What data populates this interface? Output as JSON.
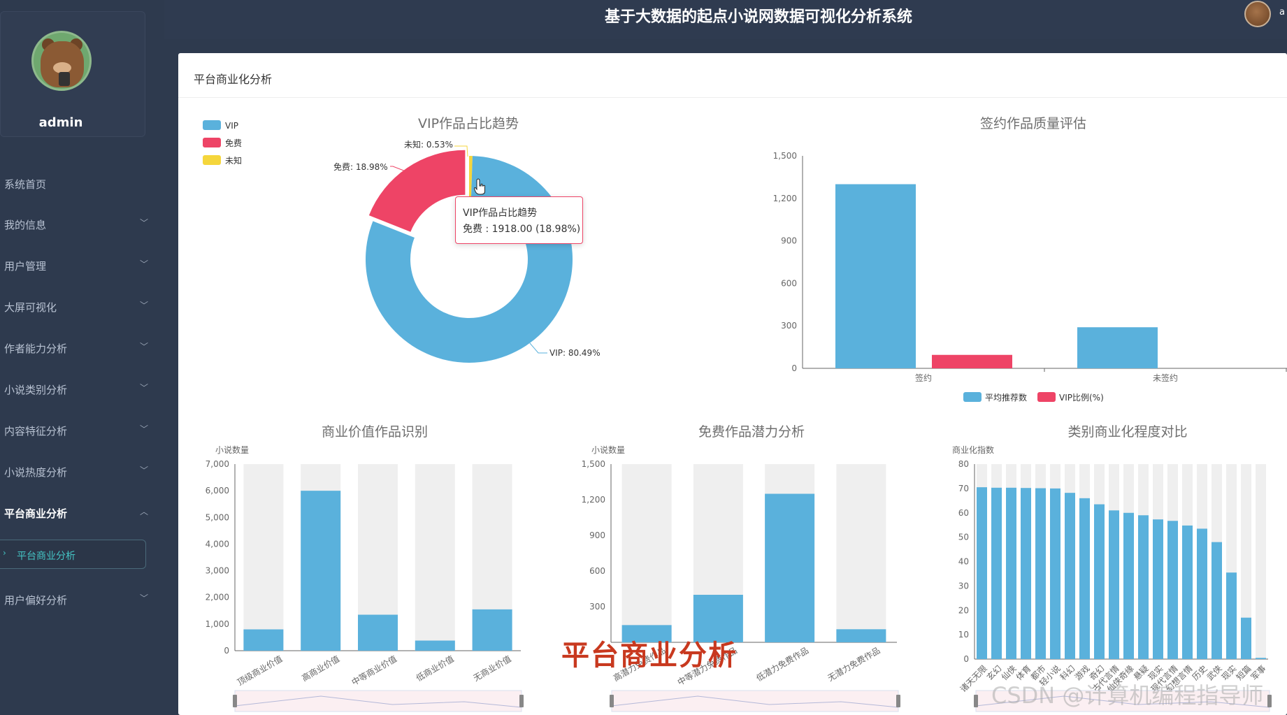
{
  "header": {
    "title": "基于大数据的起点小说网数据可视化分析系统",
    "user_initial": "a"
  },
  "sidebar": {
    "username": "admin",
    "items": [
      {
        "label": "系统首页",
        "has_arrow": false
      },
      {
        "label": "我的信息",
        "has_arrow": true
      },
      {
        "label": "用户管理",
        "has_arrow": true
      },
      {
        "label": "大屏可视化",
        "has_arrow": true
      },
      {
        "label": "作者能力分析",
        "has_arrow": true
      },
      {
        "label": "小说类别分析",
        "has_arrow": true
      },
      {
        "label": "内容特征分析",
        "has_arrow": true
      },
      {
        "label": "小说热度分析",
        "has_arrow": true
      },
      {
        "label": "平台商业分析",
        "has_arrow": true,
        "active": true
      },
      {
        "label": "用户偏好分析",
        "has_arrow": true
      }
    ],
    "submenu": {
      "label": "平台商业分析"
    }
  },
  "main": {
    "title": "平台商业化分析"
  },
  "tooltip": {
    "title": "VIP作品占比趋势",
    "value": "免费 : 1918.00 (18.98%)"
  },
  "overlay_caption": "平台商业分析",
  "watermark": "CSDN @计算机编程指导师",
  "colors": {
    "blue": "#5ab1dc",
    "pink": "#ee4466",
    "yellow": "#f5d63c",
    "bg_bar": "#efefef"
  },
  "chart_data": [
    {
      "type": "pie",
      "title": "VIP作品占比趋势",
      "legend": [
        "VIP",
        "免费",
        "未知"
      ],
      "slices": [
        {
          "name": "VIP",
          "percent": 80.49,
          "label": "VIP: 80.49%"
        },
        {
          "name": "免费",
          "value": 1918.0,
          "percent": 18.98,
          "label": "免费: 18.98%"
        },
        {
          "name": "未知",
          "percent": 0.53,
          "label": "未知: 0.53%"
        }
      ]
    },
    {
      "type": "bar",
      "title": "签约作品质量评估",
      "categories": [
        "签约",
        "未签约"
      ],
      "yticks": [
        "0",
        "300",
        "600",
        "900",
        "1,200",
        "1,500"
      ],
      "ylim": [
        0,
        1500
      ],
      "series": [
        {
          "name": "平均推荐数",
          "values": [
            1300,
            290
          ]
        },
        {
          "name": "VIP比例(%)",
          "values": [
            95,
            0
          ]
        }
      ]
    },
    {
      "type": "bar",
      "title": "商业价值作品识别",
      "ylabel": "小说数量",
      "categories": [
        "顶级商业价值",
        "高商业价值",
        "中等商业价值",
        "低商业价值",
        "无商业价值"
      ],
      "values": [
        800,
        6000,
        1350,
        380,
        1550
      ],
      "yticks": [
        "0",
        "1,000",
        "2,000",
        "3,000",
        "4,000",
        "5,000",
        "6,000",
        "7,000"
      ],
      "ylim": [
        0,
        7000
      ]
    },
    {
      "type": "bar",
      "title": "免费作品潜力分析",
      "ylabel": "小说数量",
      "categories": [
        "高潜力免费作品",
        "中等潜力免费作品",
        "低潜力免费作品",
        "无潜力免费作品"
      ],
      "values": [
        145,
        400,
        1250,
        110
      ],
      "yticks": [
        "300",
        "600",
        "900",
        "1,200",
        "1,500"
      ],
      "ylim": [
        0,
        1500
      ]
    },
    {
      "type": "bar",
      "title": "类别商业化程度对比",
      "ylabel": "商业化指数",
      "categories": [
        "诸天无限",
        "玄幻",
        "仙侠",
        "体育",
        "都市",
        "轻小说",
        "科幻",
        "游戏",
        "奇幻",
        "古代言情",
        "仙侠奇缘",
        "悬疑",
        "现实",
        "现代言情",
        "幻想言情",
        "历史",
        "武侠",
        "现实",
        "短篇",
        "军事"
      ],
      "values": [
        70.5,
        70.3,
        70.3,
        70.2,
        70.1,
        70,
        68.2,
        66,
        63.5,
        61,
        60,
        59,
        57.3,
        56.7,
        54.8,
        53.5,
        48,
        35.5,
        17,
        0.5
      ],
      "yticks": [
        "0",
        "10",
        "20",
        "30",
        "40",
        "50",
        "60",
        "70",
        "80"
      ],
      "ylim": [
        0,
        80
      ]
    }
  ]
}
